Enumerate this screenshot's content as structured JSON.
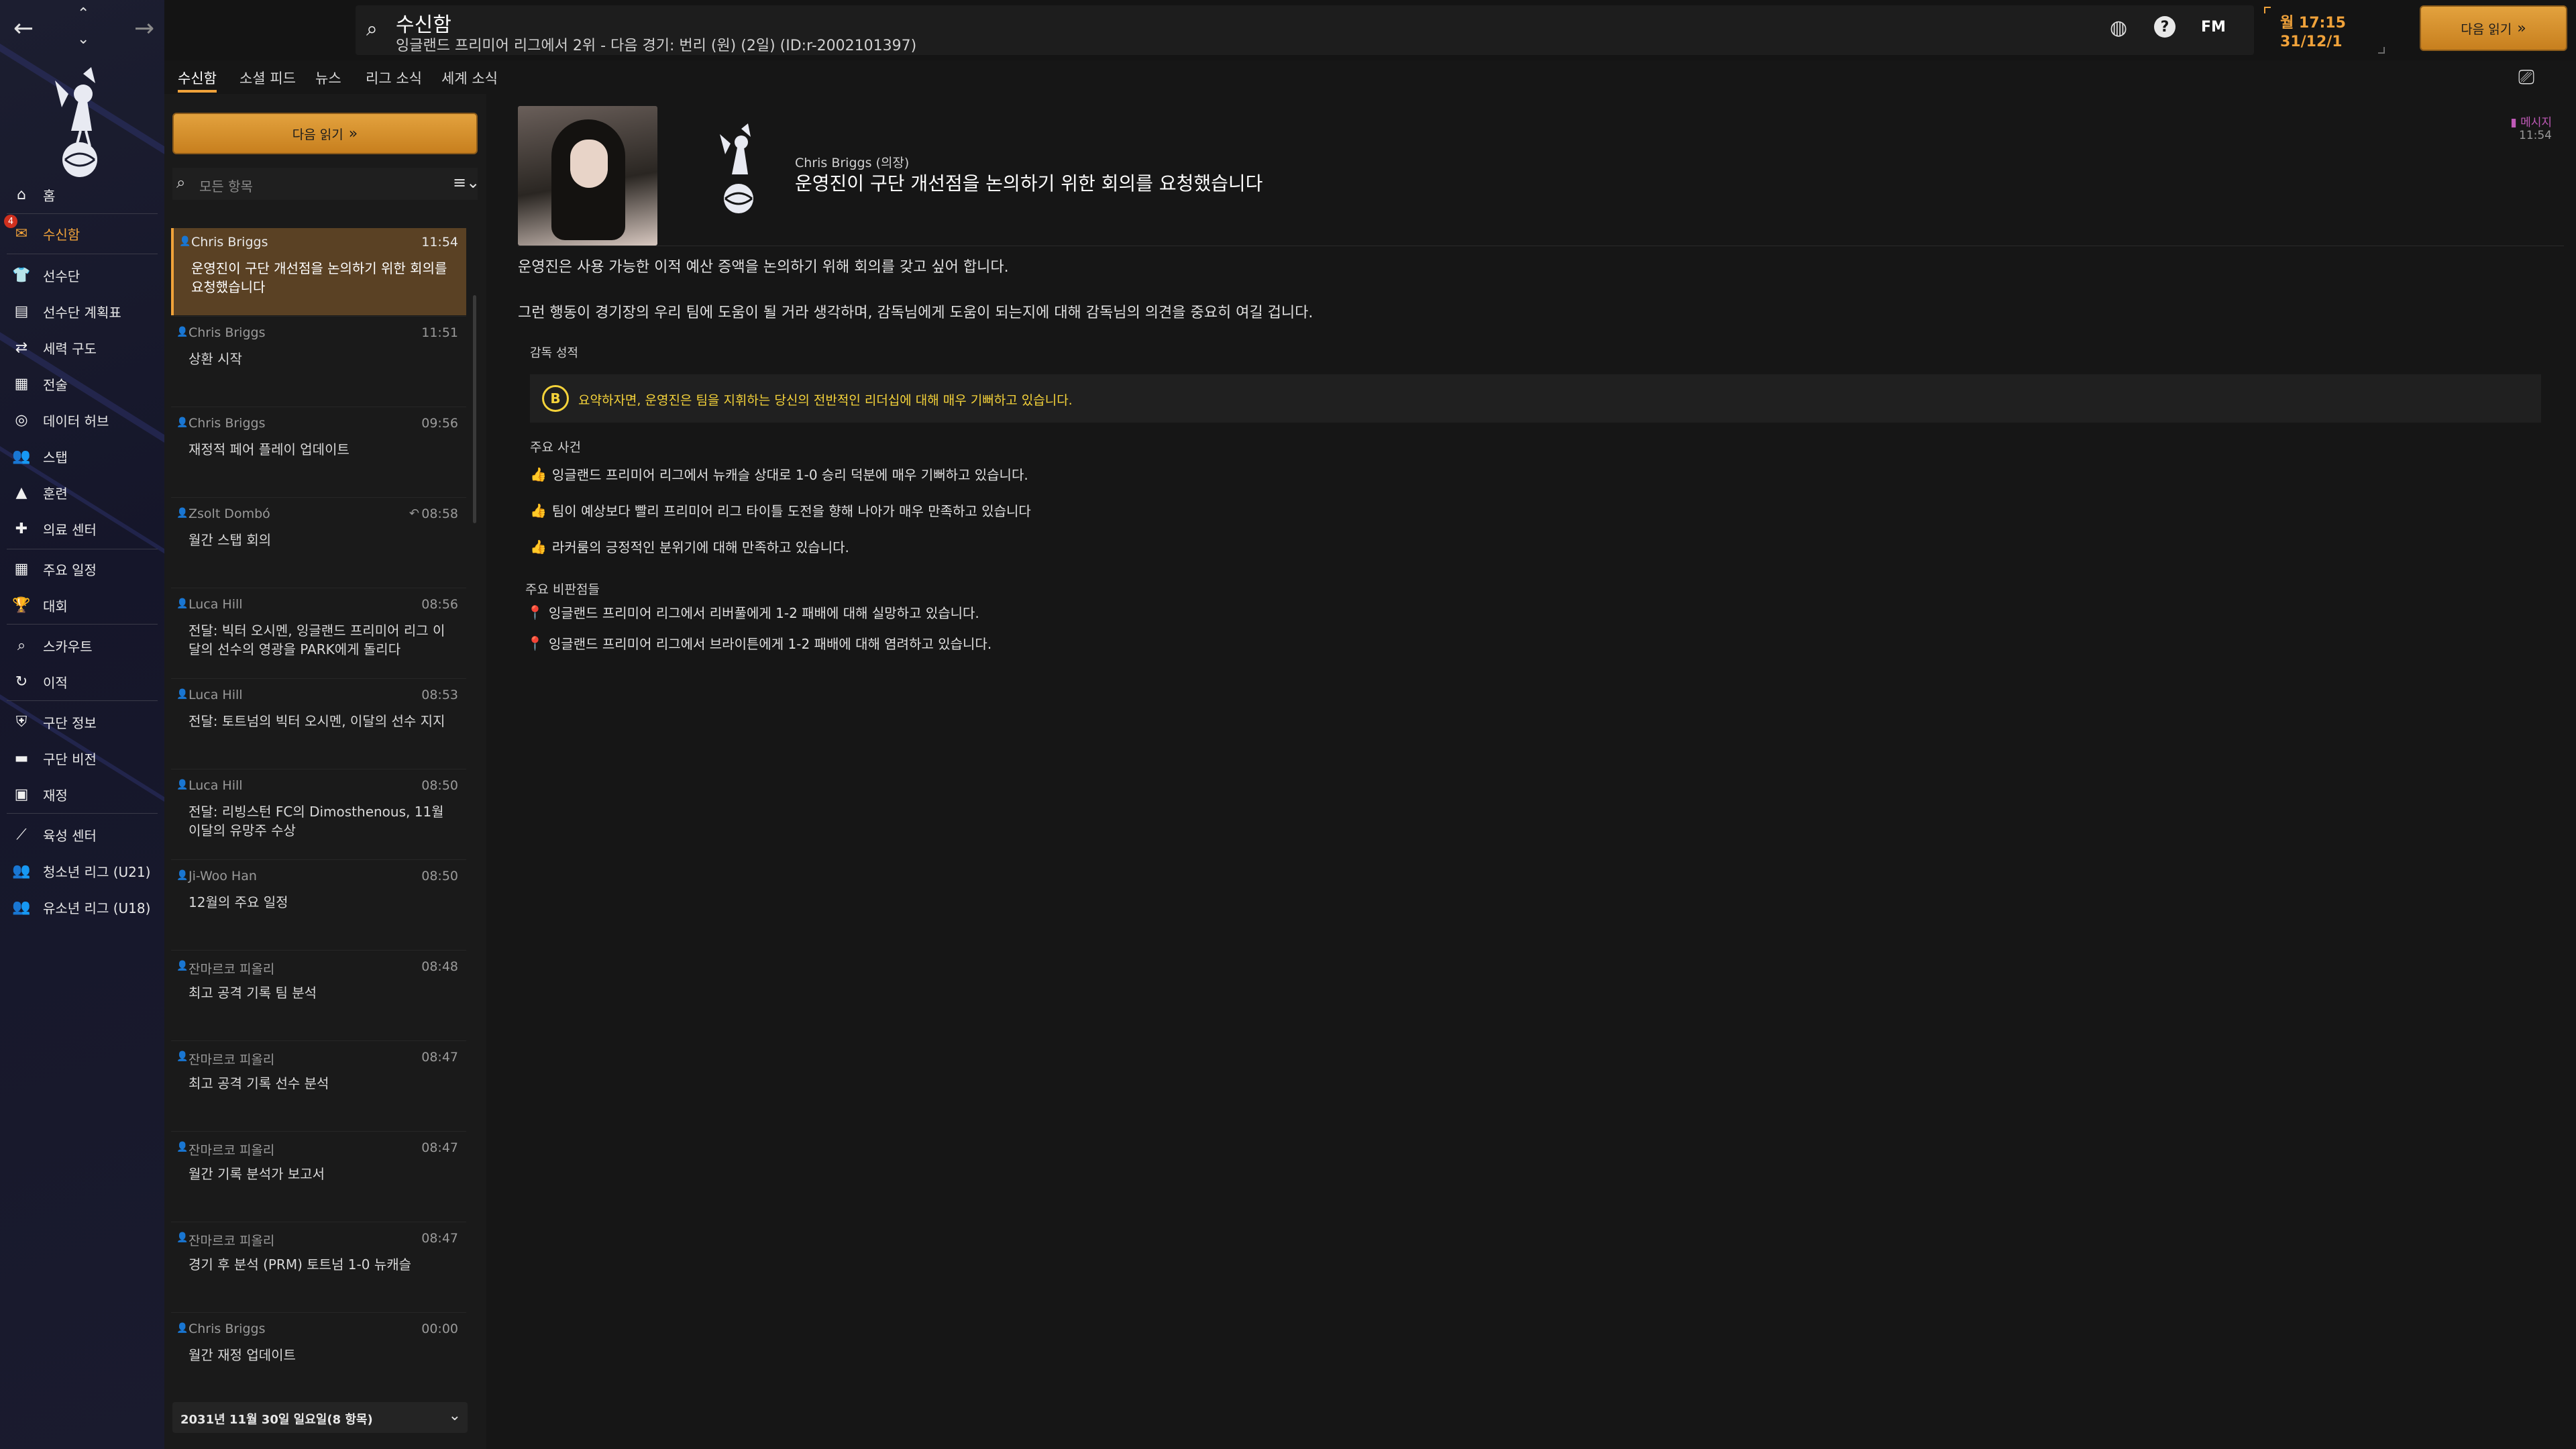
{
  "topbar": {
    "title": "수신함",
    "subtitle": "잉글랜드 프리미어 리그에서 2위 - 다음 경기: 번리 (원) (2일) (ID:r-2002101397)",
    "fm_label": "FM",
    "day_time": "월 17:15",
    "date": "31/12/1",
    "continue_label": "다음 읽기"
  },
  "sidebar": {
    "items": [
      {
        "label": "홈",
        "icon": "home-icon"
      },
      {
        "label": "수신함",
        "icon": "inbox-icon",
        "badge": "4"
      },
      {
        "label": "선수단",
        "icon": "shirt-icon"
      },
      {
        "label": "선수단 계획표",
        "icon": "clipboard-icon"
      },
      {
        "label": "세력 구도",
        "icon": "dynamics-icon"
      },
      {
        "label": "전술",
        "icon": "tactics-icon"
      },
      {
        "label": "데이터 허브",
        "icon": "data-hub-icon"
      },
      {
        "label": "스탭",
        "icon": "staff-icon"
      },
      {
        "label": "훈련",
        "icon": "training-cone-icon"
      },
      {
        "label": "의료 센터",
        "icon": "medical-icon"
      },
      {
        "label": "주요 일정",
        "icon": "calendar-icon"
      },
      {
        "label": "대회",
        "icon": "trophy-icon"
      },
      {
        "label": "스카우트",
        "icon": "scout-search-icon"
      },
      {
        "label": "이적",
        "icon": "transfer-icon"
      },
      {
        "label": "구단 정보",
        "icon": "shield-icon"
      },
      {
        "label": "구단 비전",
        "icon": "vision-icon"
      },
      {
        "label": "재정",
        "icon": "finance-icon"
      },
      {
        "label": "육성 센터",
        "icon": "development-icon"
      },
      {
        "label": "청소년 리그 (U21)",
        "icon": "u21-icon"
      },
      {
        "label": "유소년 리그 (U18)",
        "icon": "u18-icon"
      }
    ]
  },
  "tabs": [
    "수신함",
    "소셜 피드",
    "뉴스",
    "리그 소식",
    "세계 소식"
  ],
  "list": {
    "next_label": "다음 읽기",
    "search_placeholder": "모든 항목",
    "messages": [
      {
        "from": "Chris Briggs",
        "time": "11:54",
        "subject": "운영진이 구단 개선점을 논의하기 위한 회의를 요청했습니다"
      },
      {
        "from": "Chris Briggs",
        "time": "11:51",
        "subject": "상환 시작"
      },
      {
        "from": "Chris Briggs",
        "time": "09:56",
        "subject": "재정적 페어 플레이 업데이트"
      },
      {
        "from": "Zsolt Dombó",
        "time": "08:58",
        "subject": "월간 스탭 회의"
      },
      {
        "from": "Luca Hill",
        "time": "08:56",
        "subject": "전달: 빅터 오시멘, 잉글랜드 프리미어 리그 이달의 선수의 영광을 PARK에게 돌리다"
      },
      {
        "from": "Luca Hill",
        "time": "08:53",
        "subject": "전달: 토트넘의 빅터 오시멘, 이달의 선수 지지"
      },
      {
        "from": "Luca Hill",
        "time": "08:50",
        "subject": "전달: 리빙스턴 FC의 Dimosthenous, 11월 이달의 유망주 수상"
      },
      {
        "from": "Ji-Woo Han",
        "time": "08:50",
        "subject": "12월의 주요 일정"
      },
      {
        "from": "잔마르코 피올리",
        "time": "08:48",
        "subject": "최고 공격 기록 팀 분석"
      },
      {
        "from": "잔마르코 피올리",
        "time": "08:47",
        "subject": "최고 공격 기록 선수 분석"
      },
      {
        "from": "잔마르코 피올리",
        "time": "08:47",
        "subject": "월간 기록 분석가 보고서"
      },
      {
        "from": "잔마르코 피올리",
        "time": "08:47",
        "subject": "경기 후 분석 (PRM) 토트넘 1-0 뉴캐슬"
      },
      {
        "from": "Chris Briggs",
        "time": "00:00",
        "subject": "월간 재정 업데이트"
      }
    ],
    "date_group": "2031년 11월 30일 일요일(8 항목)"
  },
  "message": {
    "sender": "Chris Briggs",
    "sender_role": "(의장)",
    "title": "운영진이 구단 개선점을 논의하기 위한 회의를 요청했습니다",
    "tag": "메시지",
    "tag_time": "11:54",
    "para1": "운영진은 사용 가능한 이적 예산 증액을 논의하기 위해 회의를 갖고 싶어 합니다.",
    "para2": "그런 행동이 경기장의 우리 팀에 도움이 될 거라 생각하며, 감독님에게 도움이 되는지에 대해 감독님의 의견을 중요히 여길 겁니다.",
    "grade_heading": "감독 성적",
    "grade_letter": "B",
    "grade_text": "요약하자면, 운영진은 팀을 지휘하는 당신의 전반적인 리더십에 대해 매우 기뻐하고 있습니다.",
    "events_heading": "주요 사건",
    "positives": [
      "잉글랜드 프리미어 리그에서 뉴캐슬 상대로 1-0 승리 덕분에 매우 기뻐하고 있습니다.",
      "팀이 예상보다 빨리 프리미어 리그 타이틀 도전을 향해 나아가 매우 만족하고 있습니다",
      "라커룸의 긍정적인 분위기에 대해 만족하고 있습니다."
    ],
    "criticisms_heading": "주요 비판점들",
    "negatives": [
      "잉글랜드 프리미어 리그에서 리버풀에게 1-2 패배에 대해 실망하고 있습니다.",
      "잉글랜드 프리미어 리그에서 브라이튼에게 1-2 패배에 대해 염려하고 있습니다."
    ]
  },
  "colors": {
    "accent": "#f0a23a",
    "selected_row": "#5a4124",
    "grade_yellow": "#f5d33a",
    "positive": "#5ccc4c",
    "negative": "#e04040",
    "tag": "#c05ab8"
  }
}
